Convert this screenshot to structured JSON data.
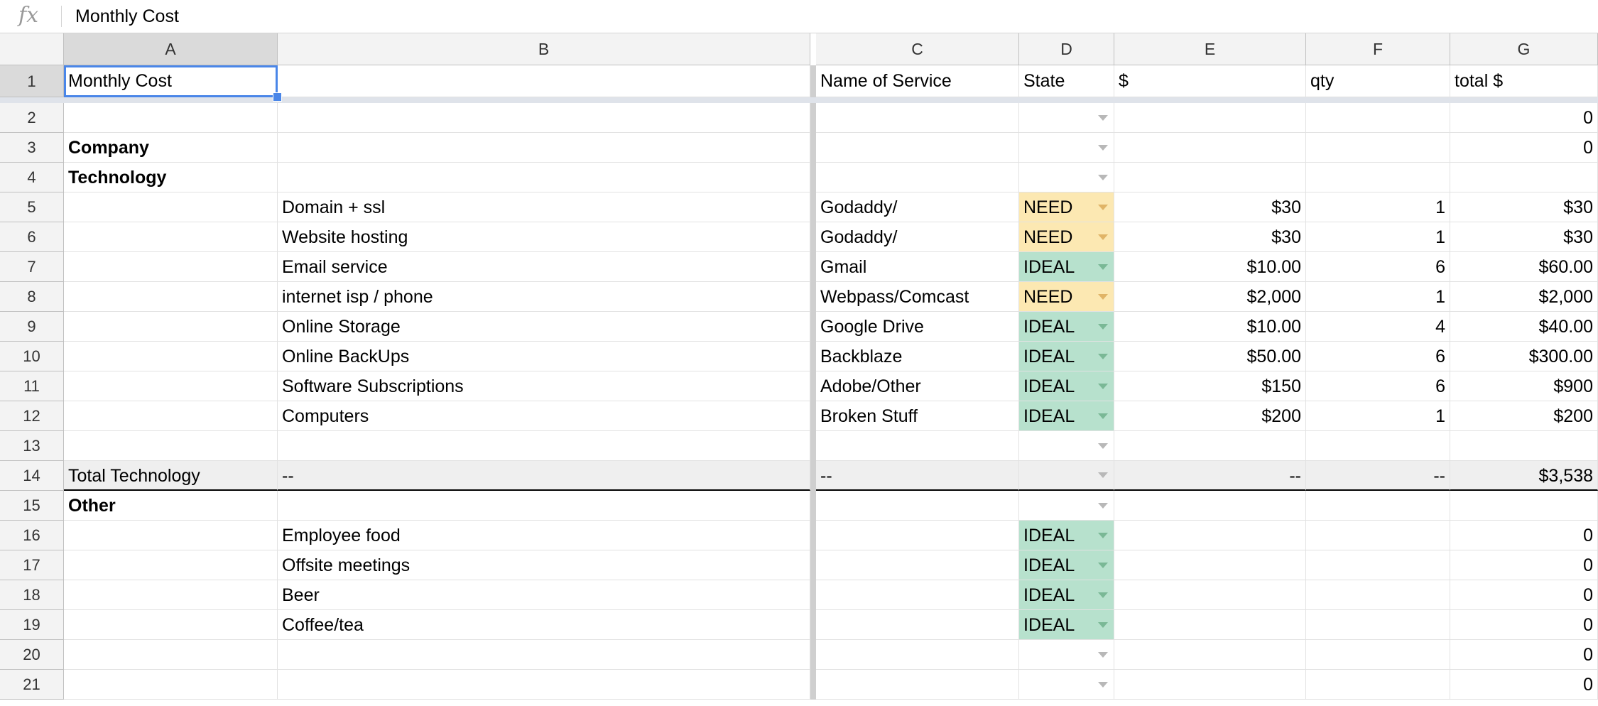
{
  "formula_bar": {
    "icon": "fx-icon",
    "value": "Monthly Cost"
  },
  "columns": [
    "A",
    "B",
    "C",
    "D",
    "E",
    "F",
    "G"
  ],
  "selected_cell": "A1",
  "rows": [
    {
      "num": "1",
      "cells": [
        "Monthly Cost",
        "",
        "Name of Service",
        "State",
        "$",
        "qty",
        "total $"
      ]
    },
    {
      "num": "2",
      "cells": [
        "",
        "",
        "",
        "",
        "",
        "",
        "0"
      ]
    },
    {
      "num": "3",
      "cells": [
        "Company",
        "",
        "",
        "",
        "",
        "",
        "0"
      ]
    },
    {
      "num": "4",
      "cells": [
        "Technology",
        "",
        "",
        "",
        "",
        "",
        ""
      ]
    },
    {
      "num": "5",
      "cells": [
        "",
        "Domain + ssl",
        "Godaddy/",
        "NEED",
        "$30",
        "1",
        "$30"
      ]
    },
    {
      "num": "6",
      "cells": [
        "",
        "Website hosting",
        "Godaddy/",
        "NEED",
        "$30",
        "1",
        "$30"
      ]
    },
    {
      "num": "7",
      "cells": [
        "",
        "Email service",
        "Gmail",
        "IDEAL",
        "$10.00",
        "6",
        "$60.00"
      ]
    },
    {
      "num": "8",
      "cells": [
        "",
        "internet isp / phone",
        "Webpass/Comcast",
        "NEED",
        "$2,000",
        "1",
        "$2,000"
      ]
    },
    {
      "num": "9",
      "cells": [
        "",
        "Online Storage",
        "Google Drive",
        "IDEAL",
        "$10.00",
        "4",
        "$40.00"
      ]
    },
    {
      "num": "10",
      "cells": [
        "",
        "Online BackUps",
        "Backblaze",
        "IDEAL",
        "$50.00",
        "6",
        "$300.00"
      ]
    },
    {
      "num": "11",
      "cells": [
        "",
        "Software Subscriptions",
        "Adobe/Other",
        "IDEAL",
        "$150",
        "6",
        "$900"
      ]
    },
    {
      "num": "12",
      "cells": [
        "",
        "Computers",
        "Broken Stuff",
        "IDEAL",
        "$200",
        "1",
        "$200"
      ]
    },
    {
      "num": "13",
      "cells": [
        "",
        "",
        "",
        "",
        "",
        "",
        ""
      ]
    },
    {
      "num": "14",
      "cells": [
        "Total Technology",
        "--",
        "--",
        "",
        "--",
        "--",
        "$3,538"
      ]
    },
    {
      "num": "15",
      "cells": [
        "Other",
        "",
        "",
        "",
        "",
        "",
        ""
      ]
    },
    {
      "num": "16",
      "cells": [
        "",
        "Employee food",
        "",
        "IDEAL",
        "",
        "",
        "0"
      ]
    },
    {
      "num": "17",
      "cells": [
        "",
        "Offsite meetings",
        "",
        "IDEAL",
        "",
        "",
        "0"
      ]
    },
    {
      "num": "18",
      "cells": [
        "",
        "Beer",
        "",
        "IDEAL",
        "",
        "",
        "0"
      ]
    },
    {
      "num": "19",
      "cells": [
        "",
        "Coffee/tea",
        "",
        "IDEAL",
        "",
        "",
        "0"
      ]
    },
    {
      "num": "20",
      "cells": [
        "",
        "",
        "",
        "",
        "",
        "",
        "0"
      ]
    },
    {
      "num": "21",
      "cells": [
        "",
        "",
        "",
        "",
        "",
        "",
        "0"
      ]
    }
  ],
  "state_colors": {
    "NEED": "#fce8b2",
    "IDEAL": "#b7e1cd"
  },
  "bold_rows": [
    "3",
    "4",
    "15"
  ],
  "dropdown_rows": [
    "2",
    "3",
    "4",
    "5",
    "6",
    "7",
    "8",
    "9",
    "10",
    "11",
    "12",
    "13",
    "14",
    "15",
    "16",
    "17",
    "18",
    "19",
    "20",
    "21"
  ]
}
